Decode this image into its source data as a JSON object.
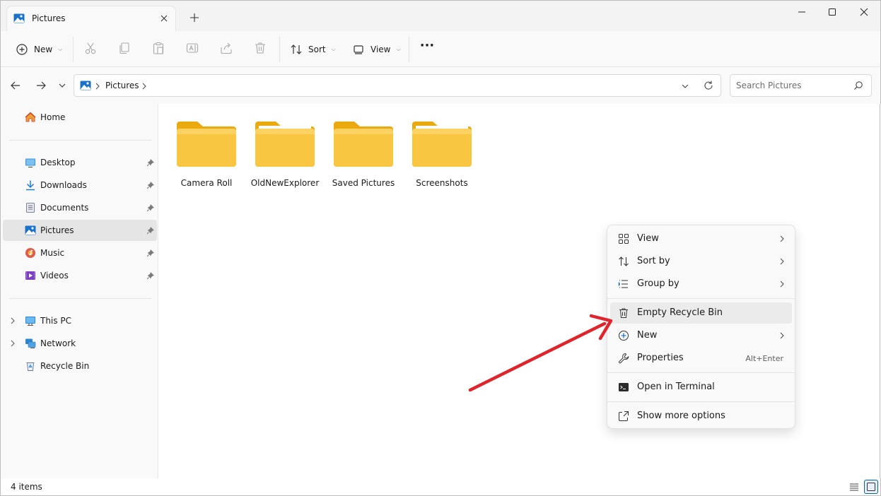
{
  "window": {
    "tab_title": "Pictures",
    "new_tab": "+"
  },
  "toolbar": {
    "new_label": "New",
    "sort_label": "Sort",
    "view_label": "View",
    "more_label": "···"
  },
  "address": {
    "crumbs": [
      "Pictures"
    ],
    "search_placeholder": "Search Pictures"
  },
  "sidebar": {
    "home": "Home",
    "quick_access": [
      {
        "label": "Desktop",
        "icon": "desktop-icon"
      },
      {
        "label": "Downloads",
        "icon": "downloads-icon"
      },
      {
        "label": "Documents",
        "icon": "documents-icon"
      },
      {
        "label": "Pictures",
        "icon": "pictures-icon",
        "selected": true
      },
      {
        "label": "Music",
        "icon": "music-icon"
      },
      {
        "label": "Videos",
        "icon": "videos-icon"
      }
    ],
    "this_pc": "This PC",
    "network": "Network",
    "recycle_bin": "Recycle Bin"
  },
  "content": {
    "folders": [
      "Camera Roll",
      "OldNewExplorer",
      "Saved Pictures",
      "Screenshots"
    ]
  },
  "status": {
    "item_count": "4 items"
  },
  "context_menu": {
    "items": [
      {
        "label": "View",
        "icon": "grid-icon",
        "submenu": true
      },
      {
        "label": "Sort by",
        "icon": "sort-icon",
        "submenu": true
      },
      {
        "label": "Group by",
        "icon": "group-icon",
        "submenu": true
      },
      {
        "label": "Empty Recycle Bin",
        "icon": "trash-icon",
        "highlighted": true
      },
      {
        "label": "New",
        "icon": "plus-circle-icon",
        "submenu": true
      },
      {
        "label": "Properties",
        "icon": "wrench-icon",
        "shortcut": "Alt+Enter"
      },
      {
        "label": "Open in Terminal",
        "icon": "terminal-icon"
      },
      {
        "label": "Show more options",
        "icon": "share-icon"
      }
    ]
  },
  "colors": {
    "folder": "#f8c640",
    "accent": "#005fb8",
    "annotation_arrow": "#e0242c"
  }
}
